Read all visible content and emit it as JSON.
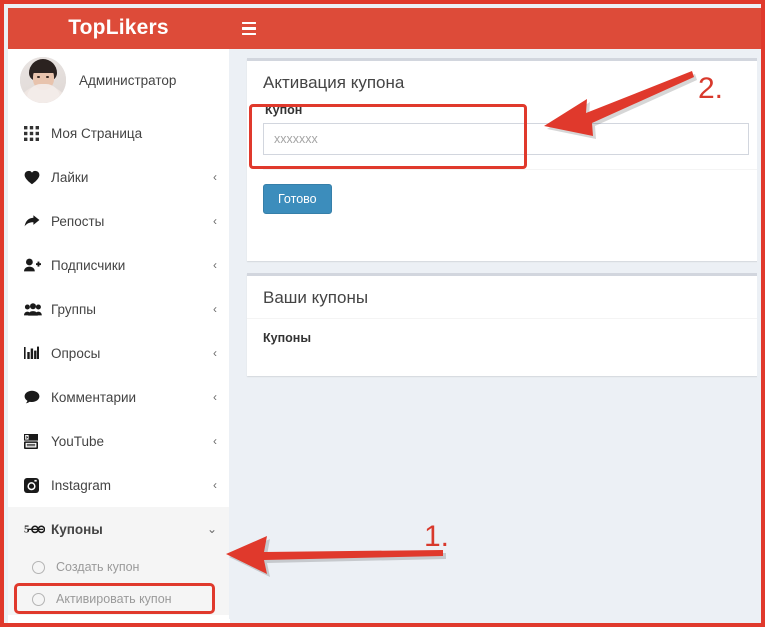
{
  "app": {
    "brand": "TopLikers",
    "menu_toggle_icon": "hamburger-icon"
  },
  "sidebar": {
    "user": {
      "name": "Администратор",
      "avatar_icon": "user-avatar"
    },
    "items": [
      {
        "label": "Моя Страница",
        "icon": "grid-icon",
        "caret": "",
        "active": false
      },
      {
        "label": "Лайки",
        "icon": "heart-icon",
        "caret": "‹",
        "active": false
      },
      {
        "label": "Репосты",
        "icon": "share-icon",
        "caret": "‹",
        "active": false
      },
      {
        "label": "Подписчики",
        "icon": "user-plus-icon",
        "caret": "‹",
        "active": false
      },
      {
        "label": "Группы",
        "icon": "users-icon",
        "caret": "‹",
        "active": false
      },
      {
        "label": "Опросы",
        "icon": "bar-chart-icon",
        "caret": "‹",
        "active": false
      },
      {
        "label": "Комментарии",
        "icon": "comment-icon",
        "caret": "‹",
        "active": false
      },
      {
        "label": "YouTube",
        "icon": "youtube-icon",
        "caret": "‹",
        "active": false
      },
      {
        "label": "Instagram",
        "icon": "instagram-icon",
        "caret": "‹",
        "active": false
      },
      {
        "label": "Купоны",
        "icon": "ticket-icon",
        "caret": "⌄",
        "active": true
      }
    ],
    "submenu": [
      {
        "label": "Создать купон",
        "icon": "circle-icon",
        "highlighted": false
      },
      {
        "label": "Активировать купон",
        "icon": "circle-icon",
        "highlighted": true
      }
    ]
  },
  "main": {
    "activation_card": {
      "title": "Активация купона",
      "field_label": "Купон",
      "field_value": "",
      "field_placeholder": "xxxxxxx",
      "submit_label": "Готово"
    },
    "coupons_card": {
      "title": "Ваши купоны",
      "table_header": "Купоны"
    }
  },
  "annotations": [
    {
      "number": "1.",
      "target": "sidebar-activate-coupon"
    },
    {
      "number": "2.",
      "target": "coupon-input-field"
    }
  ],
  "colors": {
    "brand_red": "#dd4b39",
    "frame_red": "#e0392c",
    "annotation_red": "#d8392c",
    "primary_blue": "#3c8dbc",
    "content_bg": "#ecf0f5"
  }
}
